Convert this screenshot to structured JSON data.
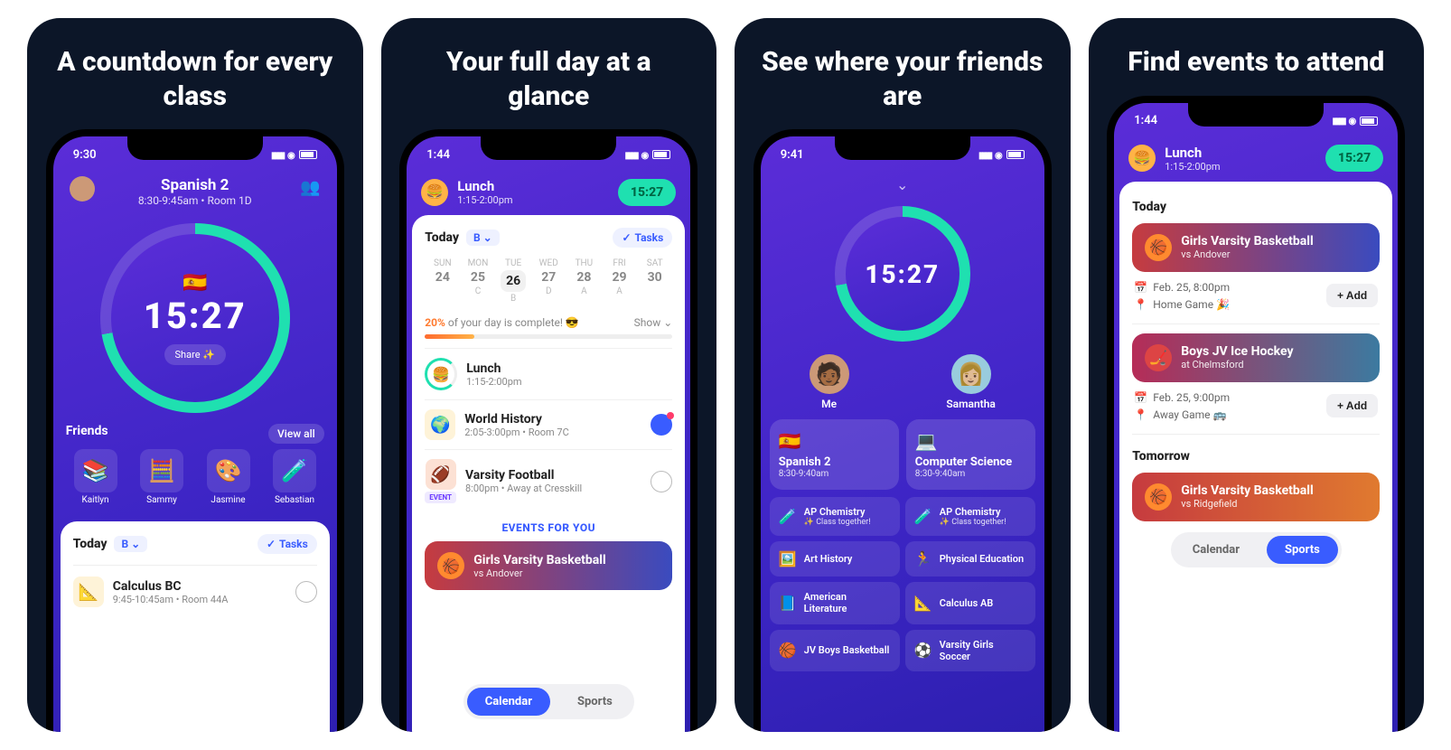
{
  "panels": [
    {
      "title": "A countdown for every class"
    },
    {
      "title": "Your full day at a glance"
    },
    {
      "title": "See where your friends are"
    },
    {
      "title": "Find events to attend"
    }
  ],
  "screen1": {
    "status_time": "9:30",
    "class_title": "Spanish 2",
    "class_sub": "8:30-9:45am • Room 1D",
    "flag": "🇪🇸",
    "countdown": "15:27",
    "share": "Share ✨",
    "friends_label": "Friends",
    "view_all": "View all",
    "friends": [
      {
        "name": "Kaitlyn",
        "emoji": "📚"
      },
      {
        "name": "Sammy",
        "emoji": "🧮"
      },
      {
        "name": "Jasmine",
        "emoji": "🎨"
      },
      {
        "name": "Sebastian",
        "emoji": "🧪"
      }
    ],
    "today_label": "Today",
    "b_chip": "B",
    "tasks_label": "Tasks",
    "row_class": "Calculus BC",
    "row_sub": "9:45-10:45am • Room 44A"
  },
  "screen2": {
    "status_time": "1:44",
    "lunch_title": "Lunch",
    "lunch_sub": "1:15-2:00pm",
    "timer": "15:27",
    "today_label": "Today",
    "b_chip": "B",
    "tasks": "Tasks",
    "days": [
      {
        "dow": "SUN",
        "num": "24",
        "let": ""
      },
      {
        "dow": "MON",
        "num": "25",
        "let": "C"
      },
      {
        "dow": "TUE",
        "num": "26",
        "let": "B",
        "active": true
      },
      {
        "dow": "WED",
        "num": "27",
        "let": "D"
      },
      {
        "dow": "THU",
        "num": "28",
        "let": "A"
      },
      {
        "dow": "FRI",
        "num": "29",
        "let": "A"
      },
      {
        "dow": "SAT",
        "num": "30",
        "let": ""
      }
    ],
    "progress_pct": "20%",
    "progress_text": " of your day is complete! 😎",
    "show": "Show",
    "items": [
      {
        "icon": "🍔",
        "title": "Lunch",
        "sub": "1:15-2:00pm",
        "ring": true
      },
      {
        "icon": "🌍",
        "title": "World History",
        "sub": "2:05-3:00pm • Room 7C",
        "chat": true
      },
      {
        "icon": "🏈",
        "title": "Varsity Football",
        "sub": "8:00pm • Away at Cresskill",
        "event": true
      }
    ],
    "events_label": "EVENTS FOR YOU",
    "event": {
      "title": "Girls Varsity Basketball",
      "sub": "vs Andover"
    },
    "tab_cal": "Calendar",
    "tab_sports": "Sports"
  },
  "screen3": {
    "status_time": "9:41",
    "countdown": "15:27",
    "me_label": "Me",
    "friend_label": "Samantha",
    "me_emoji": "🧑🏾",
    "friend_emoji": "👩🏼",
    "me_card": {
      "icon": "🇪🇸",
      "title": "Spanish 2",
      "sub": "8:30-9:40am"
    },
    "friend_card": {
      "icon": "💻",
      "title": "Computer Science",
      "sub": "8:30-9:40am"
    },
    "grid": [
      {
        "icon": "🧪",
        "title": "AP Chemistry",
        "sub": "✨ Class together!"
      },
      {
        "icon": "🧪",
        "title": "AP Chemistry",
        "sub": "✨ Class together!"
      },
      {
        "icon": "🖼️",
        "title": "Art History",
        "sub": ""
      },
      {
        "icon": "🏃",
        "title": "Physical Education",
        "sub": ""
      },
      {
        "icon": "📘",
        "title": "American Literature",
        "sub": ""
      },
      {
        "icon": "📐",
        "title": "Calculus AB",
        "sub": ""
      },
      {
        "icon": "🏀",
        "title": "JV Boys Basketball",
        "sub": ""
      },
      {
        "icon": "⚽",
        "title": "Varsity Girls Soccer",
        "sub": ""
      }
    ]
  },
  "screen4": {
    "status_time": "1:44",
    "lunch_title": "Lunch",
    "lunch_sub": "1:15-2:00pm",
    "timer": "15:27",
    "today_label": "Today",
    "tomorrow_label": "Tomorrow",
    "events": [
      {
        "title": "Girls Varsity Basketball",
        "sub": "vs Andover",
        "date": "Feb. 25, 8:00pm",
        "where": "Home Game 🎉",
        "add": "+ Add"
      },
      {
        "title": "Boys JV Ice Hockey",
        "sub": "at Chelmsford",
        "date": "Feb. 25, 9:00pm",
        "where": "Away Game 🚌",
        "add": "+ Add",
        "hockey": true
      }
    ],
    "tomorrow_event": {
      "title": "Girls Varsity Basketball",
      "sub": "vs Ridgefield"
    },
    "tab_cal": "Calendar",
    "tab_sports": "Sports"
  }
}
